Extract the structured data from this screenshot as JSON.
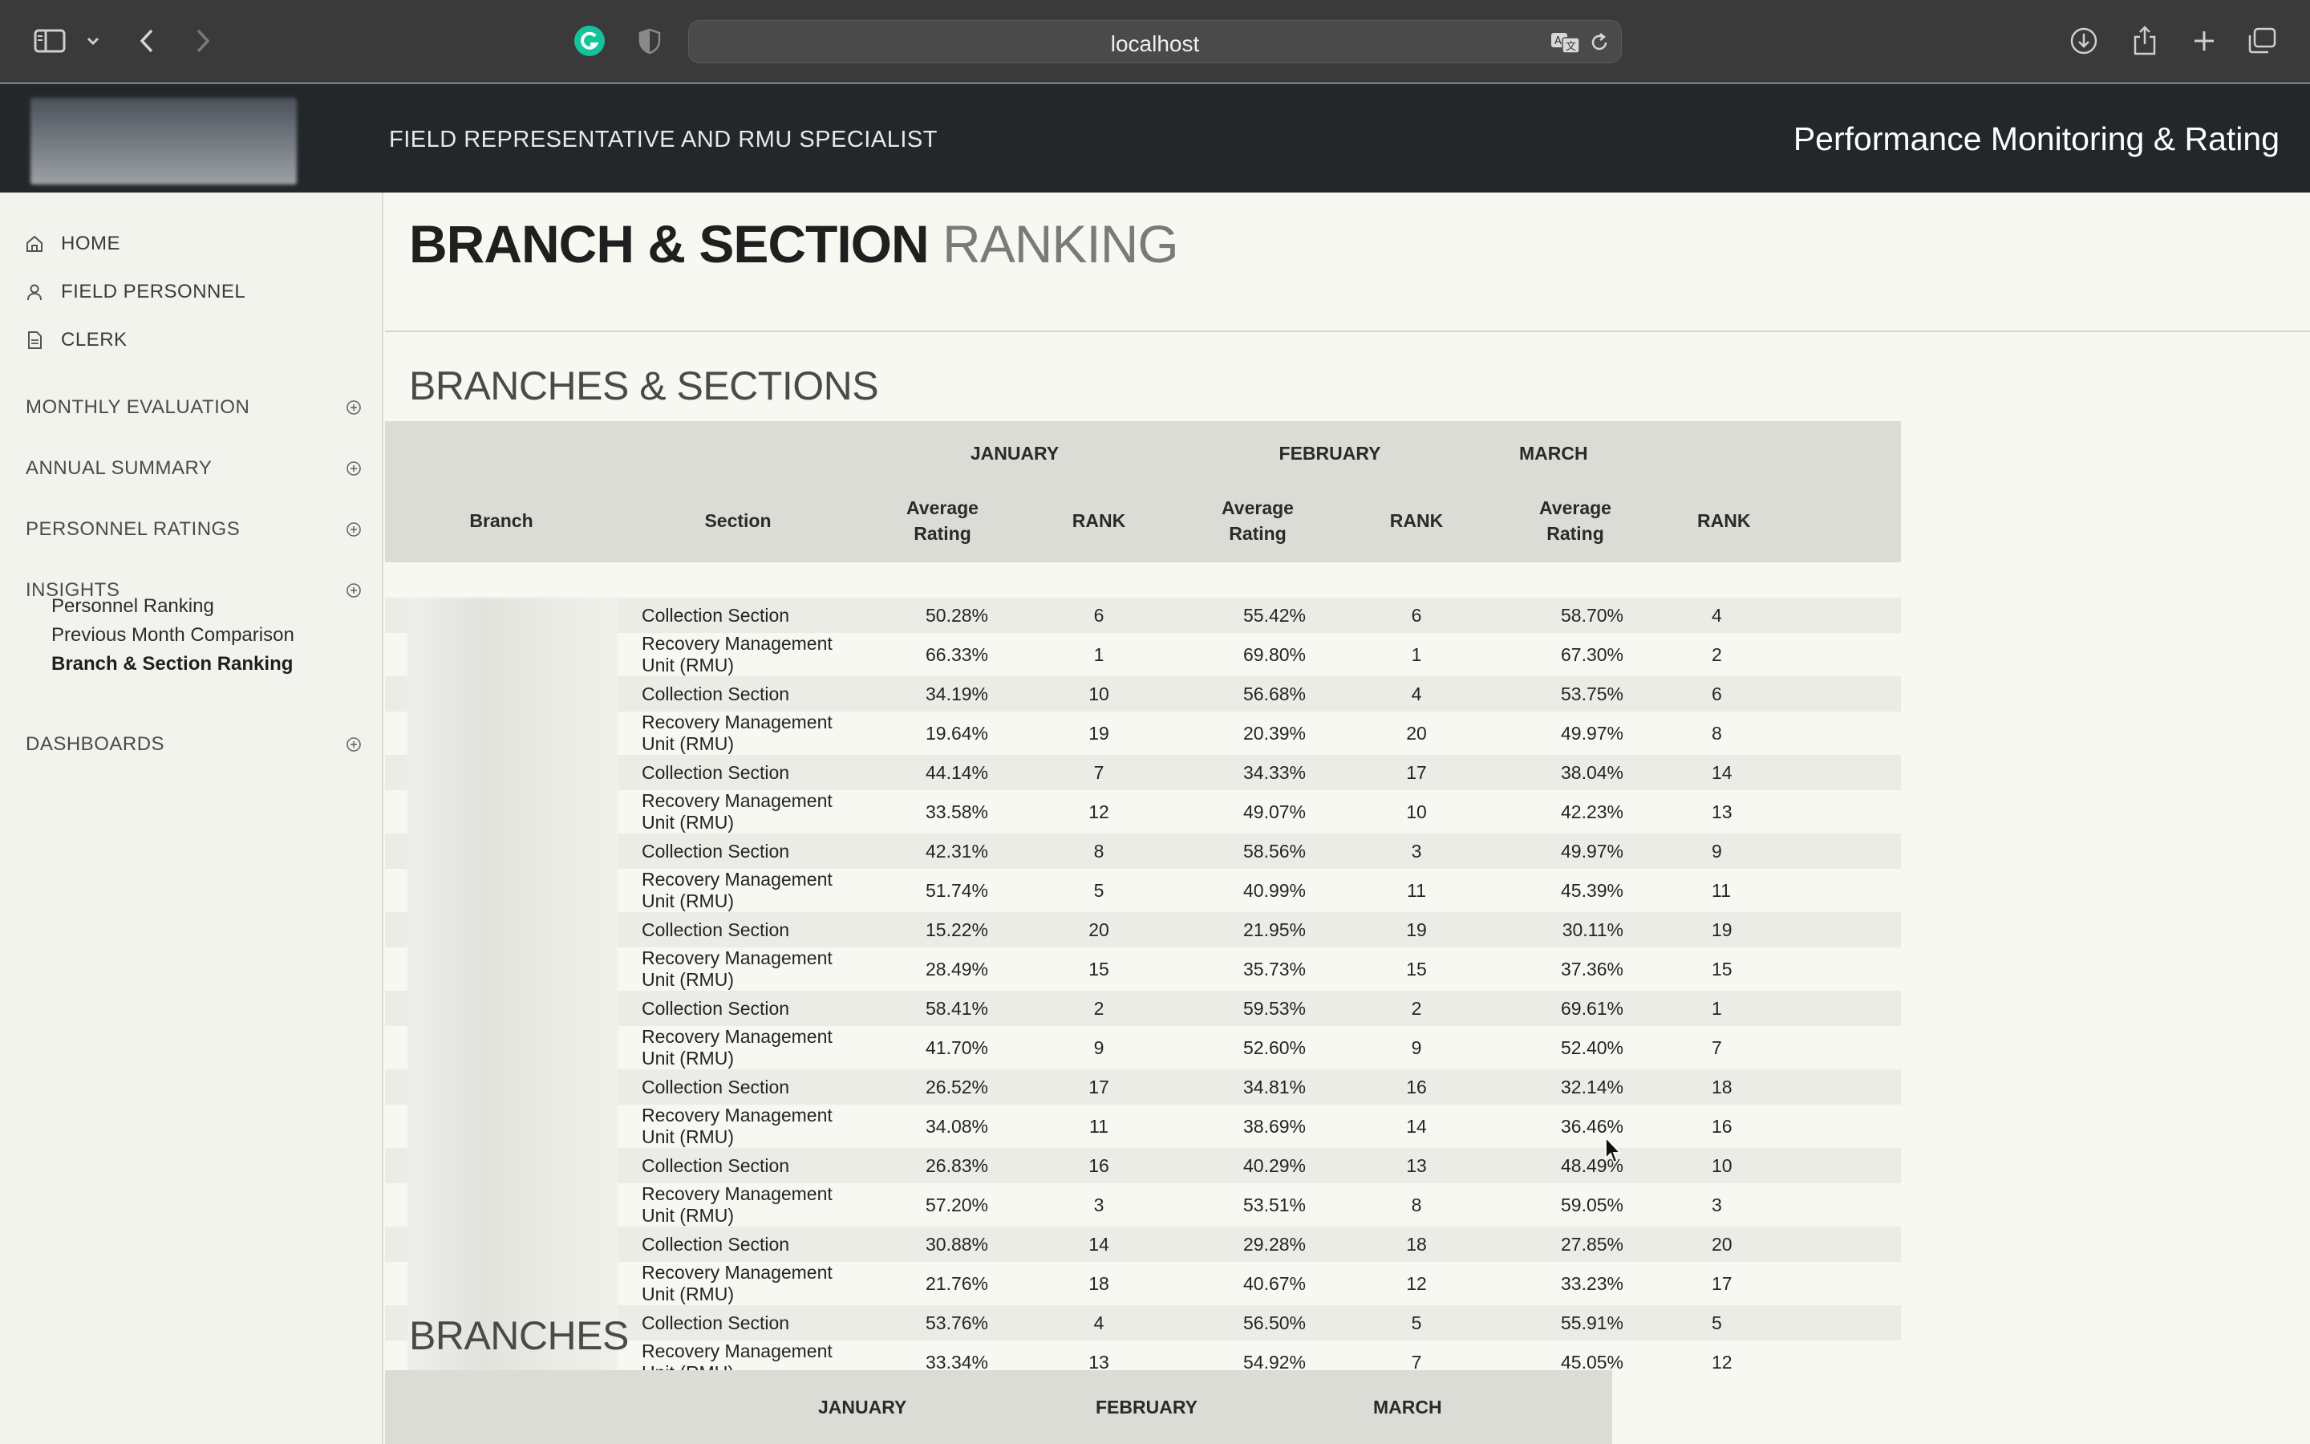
{
  "browser": {
    "url": "localhost",
    "colors": {
      "chrome_bg": "#3a3a3a",
      "grammarly": "#15c39a"
    }
  },
  "header": {
    "subtitle": "FIELD REPRESENTATIVE AND RMU SPECIALIST",
    "app_title": "Performance Monitoring & Rating"
  },
  "sidebar": {
    "top_items": [
      {
        "label": "HOME",
        "icon": "home-icon"
      },
      {
        "label": "FIELD PERSONNEL",
        "icon": "user-icon"
      },
      {
        "label": "CLERK",
        "icon": "document-icon"
      }
    ],
    "sections": [
      {
        "label": "MONTHLY EVALUATION"
      },
      {
        "label": "ANNUAL SUMMARY"
      },
      {
        "label": "PERSONNEL RATINGS"
      },
      {
        "label": "INSIGHTS"
      },
      {
        "label": "DASHBOARDS"
      }
    ],
    "insights_items": [
      {
        "label": "Personnel Ranking"
      },
      {
        "label": "Previous Month Comparison"
      },
      {
        "label": "Branch & Section Ranking",
        "active": true
      }
    ]
  },
  "page": {
    "title_bold": "BRANCH & SECTION",
    "title_light": "RANKING",
    "section1": "BRANCHES & SECTIONS",
    "section2": "BRANCHES"
  },
  "table": {
    "months": [
      "JANUARY",
      "FEBRUARY",
      "MARCH"
    ],
    "col_branch": "Branch",
    "col_section": "Section",
    "col_avg_line1": "Average",
    "col_avg_line2": "Rating",
    "col_rank": "RANK",
    "rows": [
      {
        "section": "Collection Section",
        "jan": "50.28%",
        "jan_rank": "6",
        "feb": "55.42%",
        "feb_rank": "6",
        "mar": "58.70%",
        "mar_rank": "4"
      },
      {
        "section": "Recovery Management Unit (RMU)",
        "jan": "66.33%",
        "jan_rank": "1",
        "feb": "69.80%",
        "feb_rank": "1",
        "mar": "67.30%",
        "mar_rank": "2"
      },
      {
        "section": "Collection Section",
        "jan": "34.19%",
        "jan_rank": "10",
        "feb": "56.68%",
        "feb_rank": "4",
        "mar": "53.75%",
        "mar_rank": "6"
      },
      {
        "section": "Recovery Management Unit (RMU)",
        "jan": "19.64%",
        "jan_rank": "19",
        "feb": "20.39%",
        "feb_rank": "20",
        "mar": "49.97%",
        "mar_rank": "8"
      },
      {
        "section": "Collection Section",
        "jan": "44.14%",
        "jan_rank": "7",
        "feb": "34.33%",
        "feb_rank": "17",
        "mar": "38.04%",
        "mar_rank": "14"
      },
      {
        "section": "Recovery Management Unit (RMU)",
        "jan": "33.58%",
        "jan_rank": "12",
        "feb": "49.07%",
        "feb_rank": "10",
        "mar": "42.23%",
        "mar_rank": "13"
      },
      {
        "section": "Collection Section",
        "jan": "42.31%",
        "jan_rank": "8",
        "feb": "58.56%",
        "feb_rank": "3",
        "mar": "49.97%",
        "mar_rank": "9"
      },
      {
        "section": "Recovery Management Unit (RMU)",
        "jan": "51.74%",
        "jan_rank": "5",
        "feb": "40.99%",
        "feb_rank": "11",
        "mar": "45.39%",
        "mar_rank": "11"
      },
      {
        "section": "Collection Section",
        "jan": "15.22%",
        "jan_rank": "20",
        "feb": "21.95%",
        "feb_rank": "19",
        "mar": "30.11%",
        "mar_rank": "19"
      },
      {
        "section": "Recovery Management Unit (RMU)",
        "jan": "28.49%",
        "jan_rank": "15",
        "feb": "35.73%",
        "feb_rank": "15",
        "mar": "37.36%",
        "mar_rank": "15"
      },
      {
        "section": "Collection Section",
        "jan": "58.41%",
        "jan_rank": "2",
        "feb": "59.53%",
        "feb_rank": "2",
        "mar": "69.61%",
        "mar_rank": "1"
      },
      {
        "section": "Recovery Management Unit (RMU)",
        "jan": "41.70%",
        "jan_rank": "9",
        "feb": "52.60%",
        "feb_rank": "9",
        "mar": "52.40%",
        "mar_rank": "7"
      },
      {
        "section": "Collection Section",
        "jan": "26.52%",
        "jan_rank": "17",
        "feb": "34.81%",
        "feb_rank": "16",
        "mar": "32.14%",
        "mar_rank": "18"
      },
      {
        "section": "Recovery Management Unit (RMU)",
        "jan": "34.08%",
        "jan_rank": "11",
        "feb": "38.69%",
        "feb_rank": "14",
        "mar": "36.46%",
        "mar_rank": "16"
      },
      {
        "section": "Collection Section",
        "jan": "26.83%",
        "jan_rank": "16",
        "feb": "40.29%",
        "feb_rank": "13",
        "mar": "48.49%",
        "mar_rank": "10"
      },
      {
        "section": "Recovery Management Unit (RMU)",
        "jan": "57.20%",
        "jan_rank": "3",
        "feb": "53.51%",
        "feb_rank": "8",
        "mar": "59.05%",
        "mar_rank": "3"
      },
      {
        "section": "Collection Section",
        "jan": "30.88%",
        "jan_rank": "14",
        "feb": "29.28%",
        "feb_rank": "18",
        "mar": "27.85%",
        "mar_rank": "20"
      },
      {
        "section": "Recovery Management Unit (RMU)",
        "jan": "21.76%",
        "jan_rank": "18",
        "feb": "40.67%",
        "feb_rank": "12",
        "mar": "33.23%",
        "mar_rank": "17"
      },
      {
        "section": "Collection Section",
        "jan": "53.76%",
        "jan_rank": "4",
        "feb": "56.50%",
        "feb_rank": "5",
        "mar": "55.91%",
        "mar_rank": "5"
      },
      {
        "section": "Recovery Management Unit (RMU)",
        "jan": "33.34%",
        "jan_rank": "13",
        "feb": "54.92%",
        "feb_rank": "7",
        "mar": "45.05%",
        "mar_rank": "12"
      }
    ]
  },
  "branches_table": {
    "months": [
      "JANUARY",
      "FEBRUARY",
      "MARCH"
    ]
  }
}
